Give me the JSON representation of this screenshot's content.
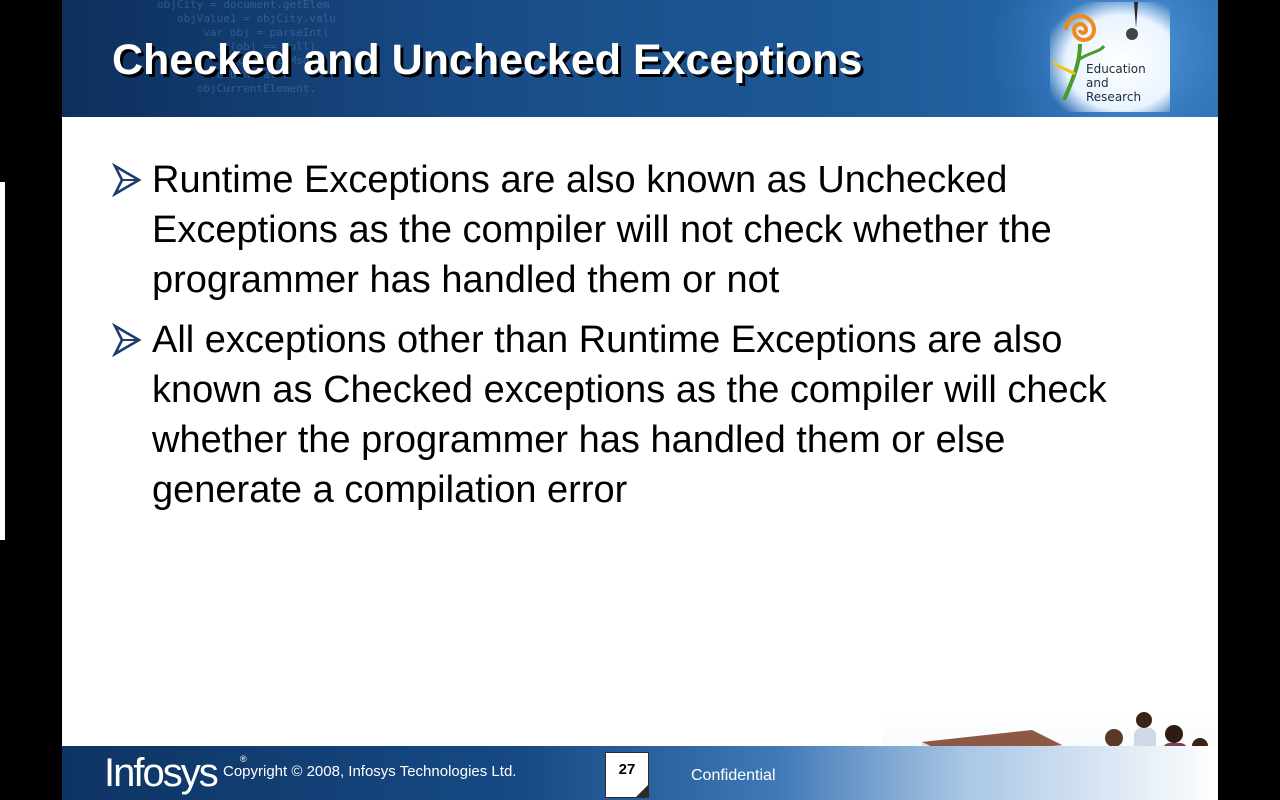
{
  "header": {
    "title": "Checked and Unchecked Exceptions",
    "logo": {
      "icon": "spiral-flower-logo-icon",
      "lines": [
        "Education",
        "and",
        "Research"
      ]
    }
  },
  "bullets": [
    {
      "icon": "arrow-bullet-icon",
      "text": "Runtime Exceptions are also known as Unchecked Exceptions as the compiler will not check whether the programmer has handled them or not"
    },
    {
      "icon": "arrow-bullet-icon",
      "text": "All exceptions other than Runtime Exceptions are also known as Checked exceptions as the compiler will check whether the programmer has handled them or else generate a compilation error"
    }
  ],
  "footer": {
    "brand": "Infosys",
    "registered": "®",
    "copyright": "Copyright © 2008, Infosys Technologies Ltd.",
    "page_number": "27",
    "confidential": "Confidential"
  },
  "colors": {
    "header_dark": "#0d2f5c",
    "header_mid": "#1e5a98",
    "footer_dark": "#0e3463",
    "bullet_arrow": "#1f3c6e",
    "title_text": "#ffffff",
    "body_text": "#000000"
  }
}
